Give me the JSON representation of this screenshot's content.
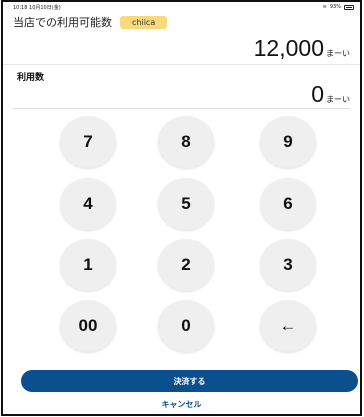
{
  "status_bar": {
    "time": "10:18",
    "date": "10月10日(金)",
    "battery": "93%"
  },
  "points": {
    "available_label": "当店での利用可能数",
    "brand": "chiica",
    "available_value": "12,000",
    "unit": "まーい"
  },
  "usage": {
    "label": "利用数",
    "value": "0",
    "unit": "まーい"
  },
  "keypad": {
    "keys": [
      "7",
      "8",
      "9",
      "4",
      "5",
      "6",
      "1",
      "2",
      "3",
      "00",
      "0",
      "←"
    ]
  },
  "actions": {
    "submit_label": "決済する",
    "cancel_label": "キャンセル"
  },
  "colors": {
    "primary": "#0b4f8f",
    "badge": "#f9d97a",
    "key_bg": "#efefef"
  }
}
